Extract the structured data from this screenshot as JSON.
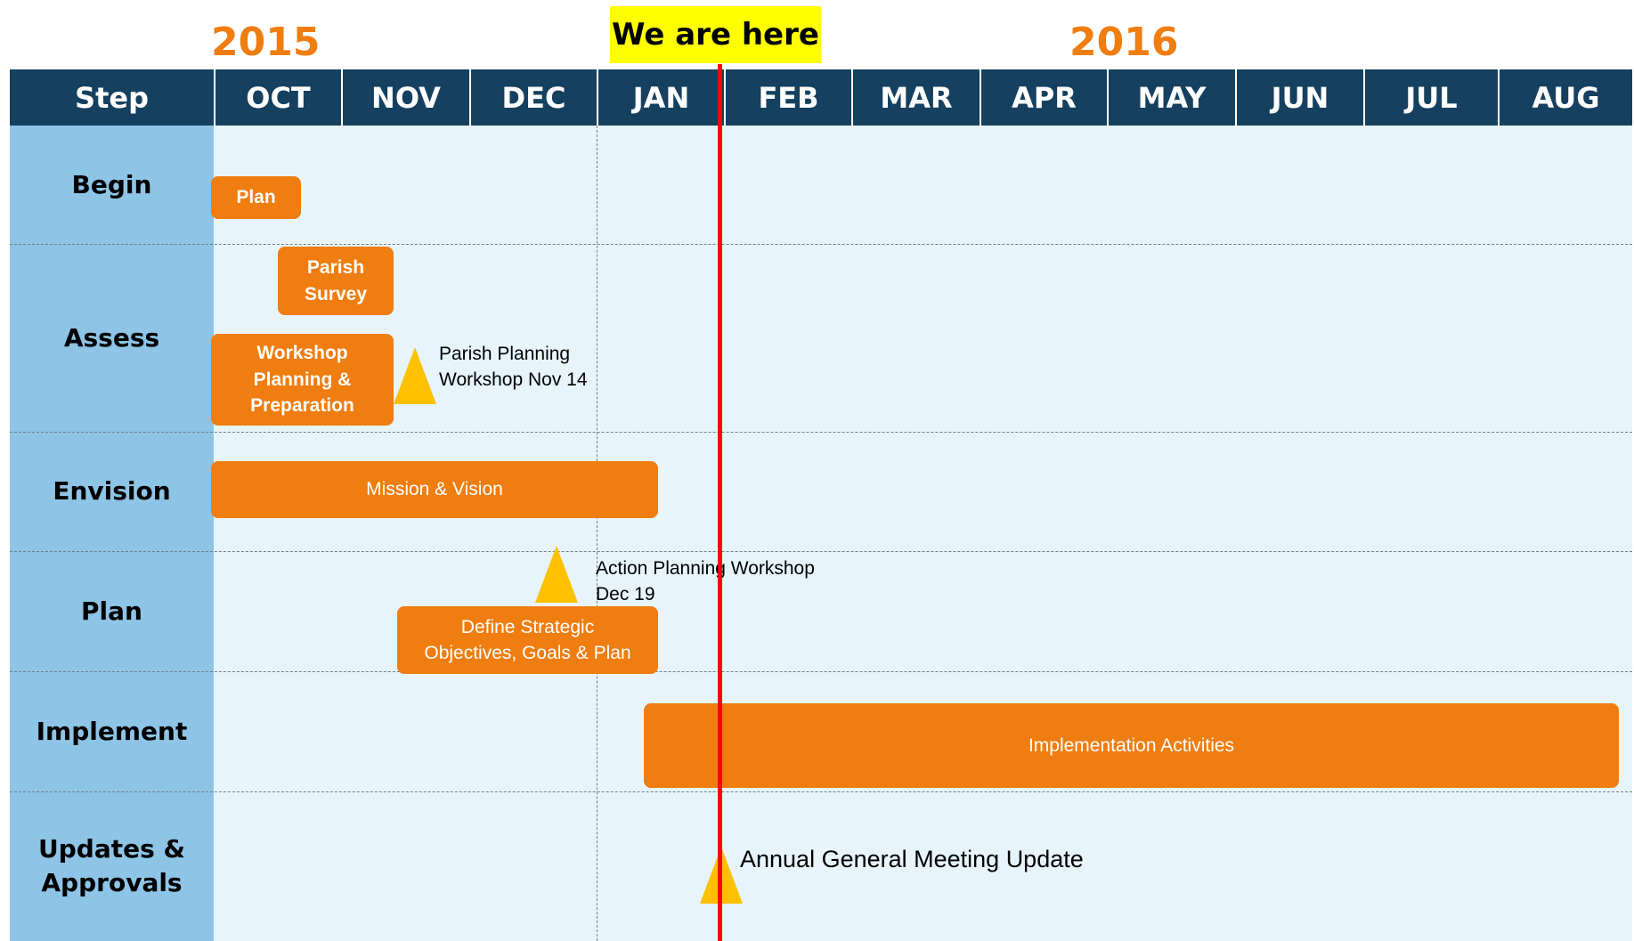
{
  "header": {
    "year_left": "2015",
    "year_right": "2016",
    "current_marker": "We are here",
    "step_header": "Step",
    "months": [
      "OCT",
      "NOV",
      "DEC",
      "JAN",
      "FEB",
      "MAR",
      "APR",
      "MAY",
      "JUN",
      "JUL",
      "AUG"
    ]
  },
  "steps": [
    "Begin",
    "Assess",
    "Envision",
    "Plan",
    "Implement",
    "Updates &\nApprovals"
  ],
  "activities": {
    "plan": "Plan",
    "parish_survey": "Parish\nSurvey",
    "workshop_prep": "Workshop\nPlanning &\nPreparation",
    "mission_vision": "Mission & Vision",
    "define_strategic": "Define Strategic\nObjectives, Goals & Plan",
    "implementation": "Implementation Activities"
  },
  "milestones": {
    "parish_workshop": "Parish Planning\nWorkshop Nov 14",
    "action_workshop": "Action Planning Workshop\nDec 19",
    "annual_meeting": "Annual General Meeting Update"
  },
  "colors": {
    "header_bg": "#15405f",
    "step_column": "#8ec4e6",
    "grid_bg": "#e7f5fb",
    "bar": "#ef7d10",
    "milestone": "#ffc000",
    "year_text": "#ef7d10",
    "current_marker_bg": "#ffff00",
    "now_line": "#ff0000"
  }
}
